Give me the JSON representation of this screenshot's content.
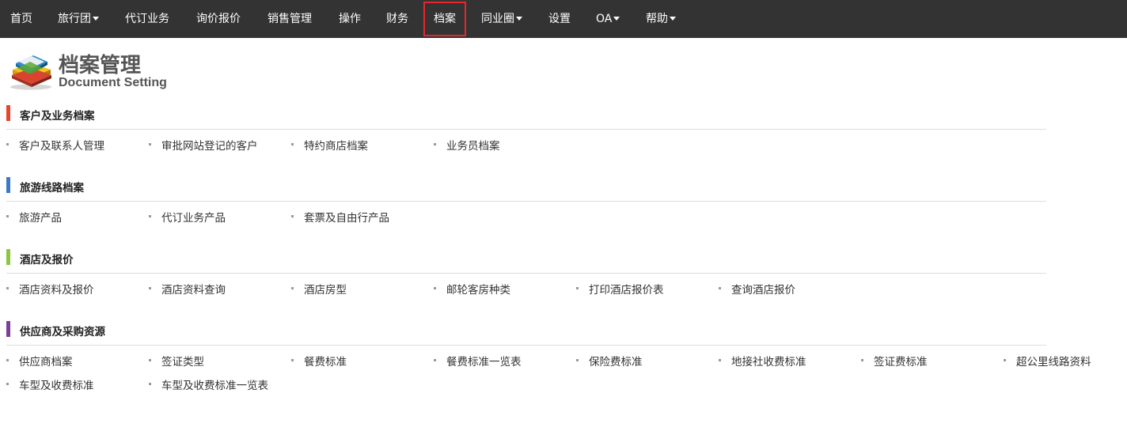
{
  "nav": {
    "items": [
      {
        "label": "首页"
      },
      {
        "label": "旅行团"
      },
      {
        "label": "代订业务"
      },
      {
        "label": "询价报价"
      },
      {
        "label": "销售管理"
      },
      {
        "label": "操作"
      },
      {
        "label": "财务"
      },
      {
        "label": "档案"
      },
      {
        "label": "同业圈"
      },
      {
        "label": "设置"
      },
      {
        "label": "OA"
      },
      {
        "label": "帮助"
      }
    ]
  },
  "header": {
    "title": "档案管理",
    "subtitle": "Document Setting"
  },
  "colors": {
    "navbar_bg": "#333333",
    "active_outline": "#e8262b",
    "customer_accent": "#e8452c",
    "travel_accent": "#3c78c8",
    "hotel_accent": "#8cc63f",
    "supplier_accent": "#7b3f98"
  },
  "sections": [
    {
      "title": "客户及业务档案",
      "links": [
        "客户及联系人管理",
        "审批网站登记的客户",
        "特约商店档案",
        "业务员档案"
      ]
    },
    {
      "title": "旅游线路档案",
      "links": [
        "旅游产品",
        "代订业务产品",
        "套票及自由行产品"
      ]
    },
    {
      "title": "酒店及报价",
      "links": [
        "酒店资料及报价",
        "酒店资料查询",
        "酒店房型",
        "邮轮客房种类",
        "打印酒店报价表",
        "查询酒店报价"
      ]
    },
    {
      "title": "供应商及采购资源",
      "links": [
        "供应商档案",
        "签证类型",
        "餐费标准",
        "餐费标准一览表",
        "保险费标准",
        "地接社收费标准",
        "签证费标准",
        "超公里线路资料",
        "车型及收费标准",
        "车型及收费标准一览表"
      ]
    }
  ]
}
